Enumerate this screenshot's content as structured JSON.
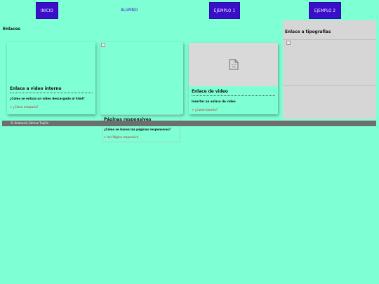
{
  "nav": {
    "inicio": "INICIO",
    "alumno": "ALUMNO",
    "ejemplo1": "EJEMPLO 1",
    "ejemplo2": "EJEMPLO 2"
  },
  "section_title": "Enlaces",
  "cards": {
    "video_interno": {
      "title": "Enlace a video interno",
      "description": "¿Cómo se enlaza un vídeo descargado al html?",
      "link": "> ¿Cómo enlazarlo?"
    },
    "paginas_responsivas": {
      "title": "Páginas responsives",
      "description": "¿Cómo se hacen las páginas responsives?",
      "link": "> Ver Página responsive"
    },
    "video": {
      "title": "Enlace de video",
      "description": "Insertar un enlace de vídeo",
      "link": "> ¿Como hacerlo?"
    },
    "tipografias": {
      "title": "Enlace a tipografias"
    }
  },
  "footer": {
    "text": "© Ambrosio Gómez Trujillo"
  },
  "colors": {
    "background": "#7fffd4",
    "nav_button": "#3a0fc9",
    "link": "#c81e1e",
    "footer": "#6e6e6e",
    "panel": "#d6d6d6"
  }
}
